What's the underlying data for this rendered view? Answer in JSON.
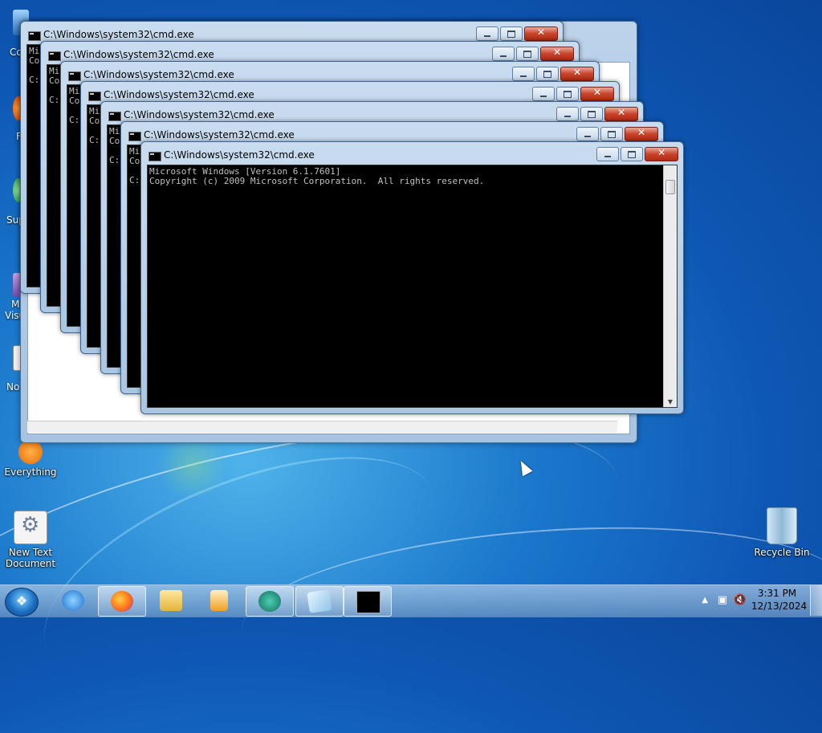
{
  "desktop": {
    "icons": [
      {
        "label": "Everything"
      },
      {
        "label": "New Text Document"
      },
      {
        "label": "Recycle Bin"
      }
    ],
    "partial_labels": [
      "Co",
      "F",
      "Sup",
      "M",
      "Visu",
      "No"
    ]
  },
  "cmd": {
    "title": "C:\\Windows\\system32\\cmd.exe",
    "line1": "Microsoft Windows [Version 6.1.7601]",
    "line2": "Copyright (c) 2009 Microsoft Corporation.  All rights reserved.",
    "partial_line1": "Mi",
    "partial_line2": "Co",
    "partial_prompt": "C:"
  },
  "taskbar": {
    "time": "3:31 PM",
    "date": "12/13/2024",
    "apps": [
      {
        "name": "internet-explorer"
      },
      {
        "name": "firefox"
      },
      {
        "name": "file-explorer"
      },
      {
        "name": "media-player"
      },
      {
        "name": "app-green"
      },
      {
        "name": "notepad"
      },
      {
        "name": "cmd"
      }
    ]
  },
  "colors": {
    "desktop_blue": "#1b78cc",
    "cmd_background": "#000000",
    "cmd_text": "#c0c0c0",
    "close_red": "#c7442b"
  }
}
